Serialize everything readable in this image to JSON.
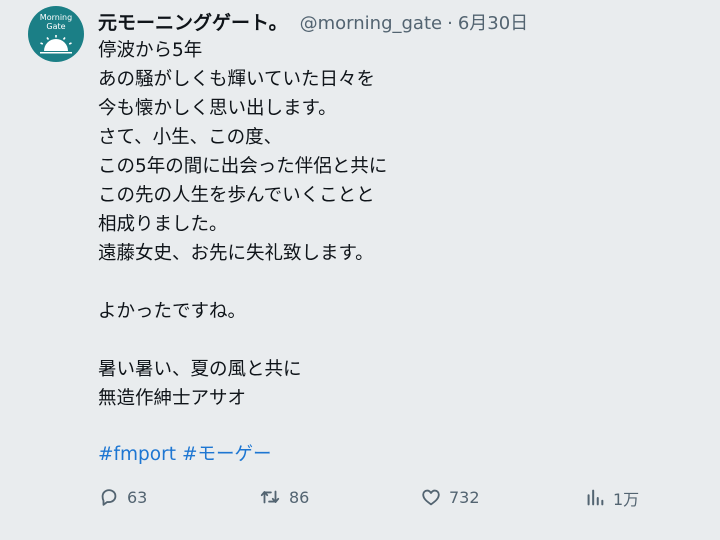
{
  "tweet": {
    "avatar_text": [
      "Morning",
      "Gate"
    ],
    "display_name": "元モーニングゲート。",
    "handle": "@morning_gate",
    "separator": "·",
    "date": "6月30日",
    "lines": [
      "停波から5年",
      "あの騒がしくも輝いていた日々を",
      "今も懐かしく思い出します。",
      "さて、小生、この度、",
      "この5年の間に出会った伴侶と共に",
      "この先の人生を歩んでいくことと",
      "相成りました。",
      "遠藤女史、お先に失礼致します。",
      "",
      "よかったですね。",
      "",
      "暑い暑い、夏の風と共に",
      "無造作紳士アサオ"
    ],
    "hashtags": [
      "#fmport",
      "#モーゲー"
    ],
    "actions": {
      "replies": "63",
      "retweets": "86",
      "likes": "732",
      "views": "1万"
    }
  },
  "colors": {
    "background": "#e9ecee",
    "text": "#0f1419",
    "muted": "#536471",
    "link": "#1d76d2",
    "avatar_bg": "#1b7f86"
  },
  "icons": [
    "reply-icon",
    "retweet-icon",
    "like-icon",
    "views-icon"
  ]
}
